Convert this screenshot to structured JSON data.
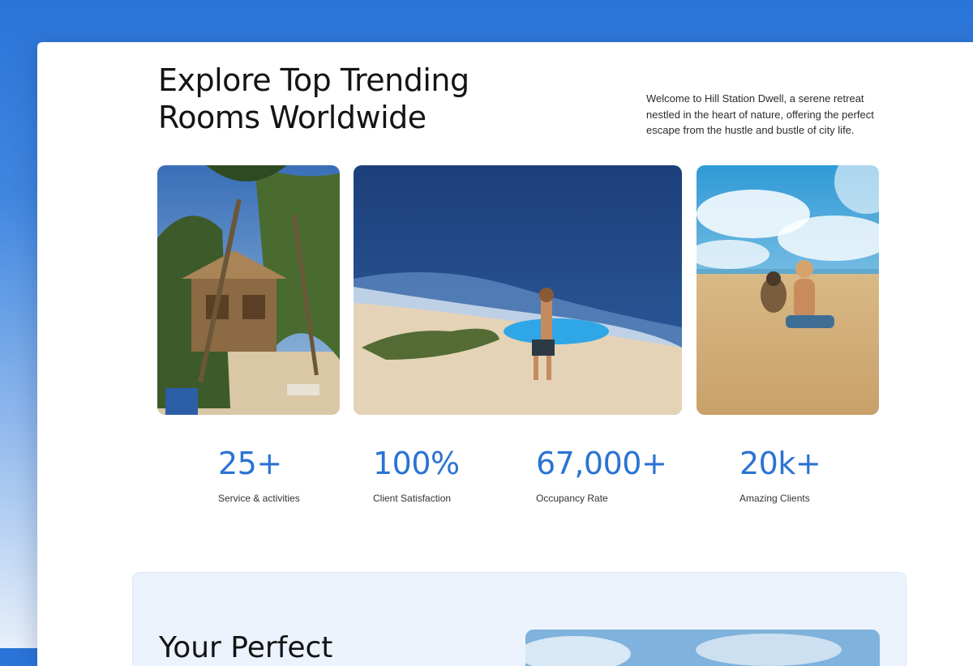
{
  "section": {
    "title": "Explore Top Trending Rooms Worldwide",
    "intro": "Welcome to Hill Station Dwell, a serene retreat nestled in the heart of nature, offering the perfect escape from the hustle and bustle of city life."
  },
  "gallery": {
    "images": [
      "beach-hut-photo",
      "surfer-photo",
      "boy-with-dog-photo"
    ]
  },
  "stats": [
    {
      "value": "25+",
      "label": "Service & activities"
    },
    {
      "value": "100%",
      "label": "Client Satisfaction"
    },
    {
      "value": "67,000+",
      "label": "Occupancy Rate"
    },
    {
      "value": "20k+",
      "label": "Amazing Clients"
    }
  ],
  "lower_section": {
    "title": "Your Perfect"
  },
  "colors": {
    "accent": "#2b73d3",
    "background_top": "#2a74d8",
    "panel": "#ecf3fd"
  }
}
